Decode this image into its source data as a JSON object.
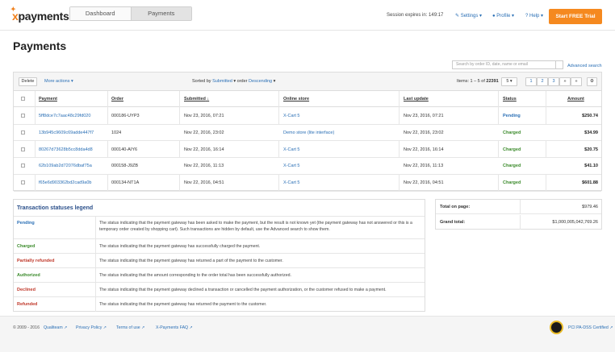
{
  "header": {
    "logo": "payments",
    "tabs": [
      "Dashboard",
      "Payments"
    ],
    "session": "Session expires in: 149:17",
    "menu": {
      "settings": "Settings",
      "profile": "Profile",
      "help": "Help"
    },
    "trial_button": "Start FREE Trial"
  },
  "page_title": "Payments",
  "search": {
    "placeholder": "Search by order ID, date, name or email",
    "advanced": "Advanced search"
  },
  "toolbar": {
    "delete": "Delete",
    "more_actions": "More actions",
    "sorted_by_label": "Sorted by",
    "sorted_by_value": "Submitted",
    "order_label": "order",
    "order_value": "Descending",
    "items_text": "Items: 1 – 5 of",
    "items_total": "22391",
    "per_page": "5",
    "pages": [
      "1",
      "2",
      "3",
      "»",
      "»"
    ]
  },
  "columns": [
    "Payment",
    "Order",
    "Submitted",
    "Online store",
    "Last update",
    "Status",
    "Amount"
  ],
  "rows": [
    {
      "payment": "5ff8dce7c7aac48c29fd020",
      "order": "000186-UYP3",
      "submitted": "Nov 23, 2016, 07:21",
      "store": "X-Cart 5",
      "last_update": "Nov 23, 2016, 07:21",
      "status": "Pending",
      "amount": "$250.74"
    },
    {
      "payment": "13b945c9609c69adde447f7",
      "order": "1024",
      "submitted": "Nov 22, 2016, 23:02",
      "store": "Demo store (lite interface)",
      "last_update": "Nov 22, 2016, 23:02",
      "status": "Charged",
      "amount": "$34.99"
    },
    {
      "payment": "80267d73628b5cc8dda4d8",
      "order": "000140-AIY6",
      "submitted": "Nov 22, 2016, 16:14",
      "store": "X-Cart 5",
      "last_update": "Nov 22, 2016, 16:14",
      "status": "Charged",
      "amount": "$20.75"
    },
    {
      "payment": "62b109ab2d72076dbaf75a",
      "order": "000158-J9ZB",
      "submitted": "Nov 22, 2016, 11:13",
      "store": "X-Cart 5",
      "last_update": "Nov 22, 2016, 11:13",
      "status": "Charged",
      "amount": "$41.10"
    },
    {
      "payment": "f65e6d903362bd2cad9a0b",
      "order": "000134-NT1A",
      "submitted": "Nov 22, 2016, 04:51",
      "store": "X-Cart 5",
      "last_update": "Nov 22, 2016, 04:51",
      "status": "Charged",
      "amount": "$601.88"
    }
  ],
  "legend": {
    "title": "Transaction statuses legend",
    "items": [
      {
        "name": "Pending",
        "color": "#2a6fb5",
        "desc": "The status indicating that the payment gateway has been asked to make the payment, but the result is not known yet (the payment gateway has not answered or this is a temporary order created by shopping cart). Such transactions are hidden by default, use the Advanced search to show them."
      },
      {
        "name": "Charged",
        "color": "#3a8a2a",
        "desc": "The status indicating that the payment gateway has successfully charged the payment."
      },
      {
        "name": "Partially refunded",
        "color": "#c0392b",
        "desc": "The status indicating that the payment gateway has returned a part of the payment to the customer."
      },
      {
        "name": "Authorized",
        "color": "#3a8a2a",
        "desc": "The status indicating that the amount corresponding to the order total has been successfully authorized."
      },
      {
        "name": "Declined",
        "color": "#c0392b",
        "desc": "The status indicating that the payment gateway declined a transaction or cancelled the payment authorization, or the customer refused to make a payment."
      },
      {
        "name": "Refunded",
        "color": "#c0392b",
        "desc": "The status indicating that the payment gateway has returned the payment to the customer."
      }
    ]
  },
  "totals": {
    "page_label": "Total on page:",
    "page_value": "$979.46",
    "grand_label": "Grand total:",
    "grand_value": "$1,000,005,042,769.26"
  },
  "footer": {
    "copyright": "© 2009 - 2016",
    "links": [
      "Qualiteam",
      "Privacy Policy",
      "Terms of use",
      "X-Payments FAQ"
    ],
    "pci": "PCI PA-DSS Certified"
  }
}
